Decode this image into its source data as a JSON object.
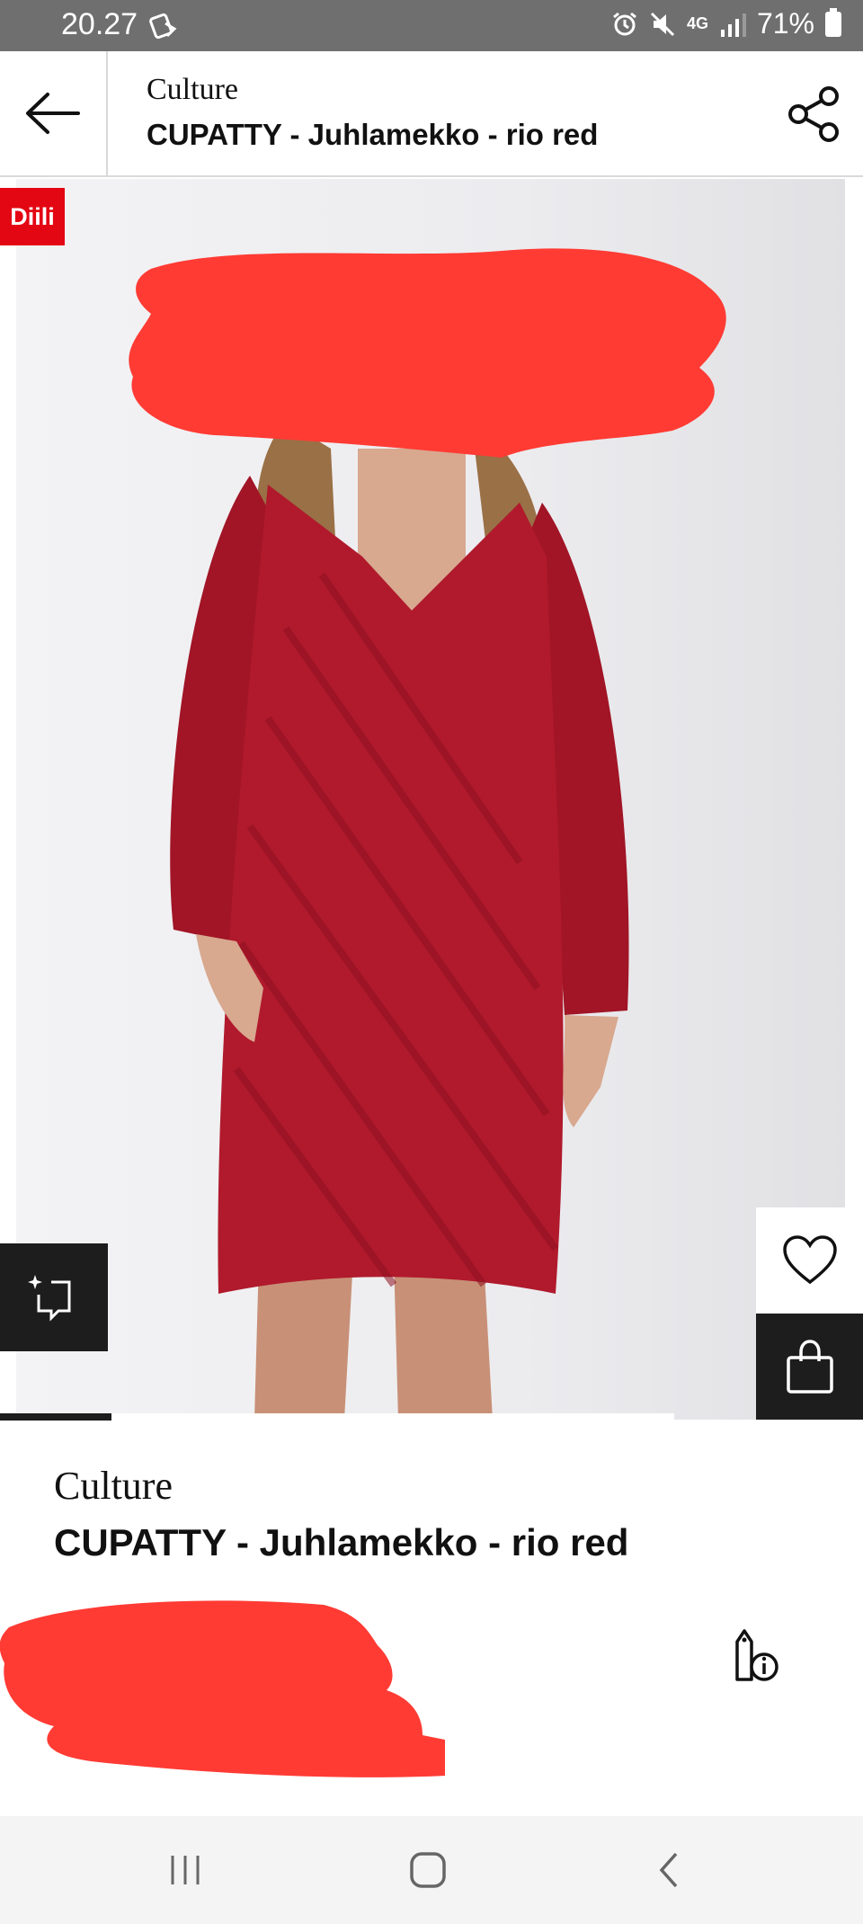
{
  "status": {
    "time": "20.27",
    "network": "4G",
    "battery": "71%"
  },
  "header": {
    "brand": "Culture",
    "title": "CUPATTY  - Juhlamekko - rio red",
    "back_icon": "arrow-left-icon",
    "share_icon": "share-icon"
  },
  "product_image": {
    "badge": "Diili"
  },
  "actions": {
    "compare_icon": "compare-icon",
    "wishlist_icon": "heart-icon",
    "cart_icon": "shopping-bag-icon"
  },
  "product": {
    "brand": "Culture",
    "title": "CUPATTY  - Juhlamekko - rio red",
    "price_info_icon": "price-tag-info-icon"
  },
  "colors": {
    "accent_red": "#e30613",
    "redaction": "#ff3b34",
    "dark": "#1d1d1d"
  },
  "nav": {
    "recent_icon": "recent-apps-icon",
    "home_icon": "home-icon",
    "back_icon": "back-chevron-icon"
  }
}
